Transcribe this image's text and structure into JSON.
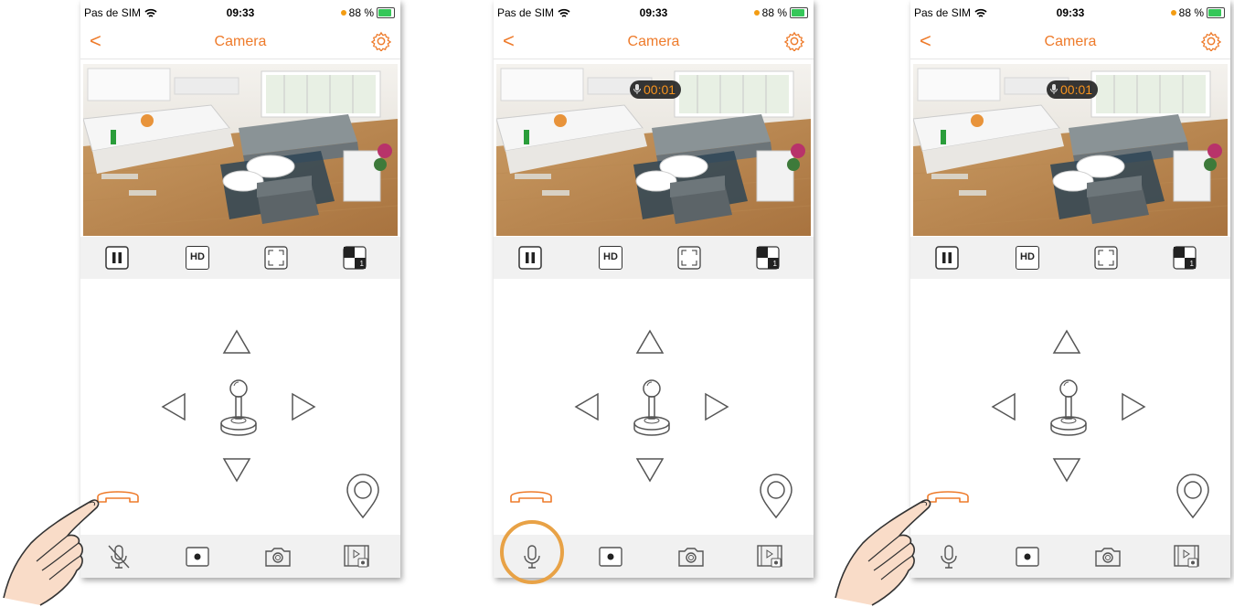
{
  "status": {
    "carrier": "Pas de SIM",
    "time": "09:33",
    "battery": "88 %"
  },
  "nav": {
    "back_label": "<",
    "title": "Camera"
  },
  "recording": {
    "timer": "00:01"
  },
  "toolbar": {
    "hd_label": "HD",
    "split_badge": "1"
  },
  "colors": {
    "accent": "#ee7b2b",
    "toolbar_bg": "#f1f1f1",
    "highlight": "#e8a246"
  },
  "icons": [
    "wifi-icon",
    "battery-icon",
    "settings-gear-icon",
    "pause-icon",
    "hd-icon",
    "fullscreen-icon",
    "split-view-icon",
    "arrow-up-icon",
    "arrow-left-icon",
    "arrow-right-icon",
    "arrow-down-icon",
    "joystick-icon",
    "phone-call-icon",
    "location-pin-icon",
    "microphone-icon",
    "microphone-muted-icon",
    "record-icon",
    "snapshot-camera-icon",
    "playback-gallery-icon"
  ],
  "screens": [
    {
      "mic_state": "muted",
      "recording": false,
      "pointer_target": "phone-call-button"
    },
    {
      "mic_state": "on",
      "recording": true,
      "pointer_target": "microphone-button"
    },
    {
      "mic_state": "on",
      "recording": true,
      "pointer_target": "phone-call-button"
    }
  ]
}
